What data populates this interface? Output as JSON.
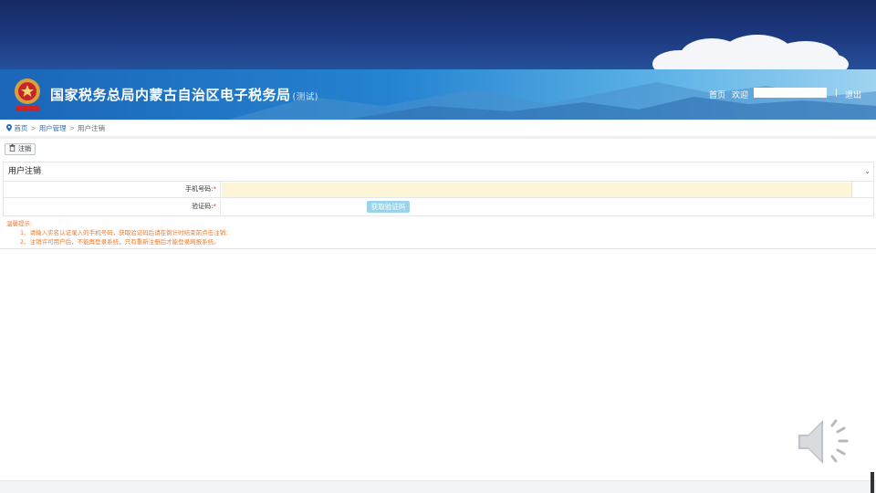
{
  "site": {
    "title": "国家税务总局内蒙古自治区电子税务局",
    "title_suffix": "(测试)"
  },
  "header_links": {
    "home": "首页",
    "welcome": "欢迎",
    "separator": "|",
    "logout": "退出"
  },
  "breadcrumb": {
    "home": "首页",
    "sep1": ">",
    "user_mgmt": "用户管理",
    "sep2": ">",
    "current": "用户注销"
  },
  "toolbar": {
    "cancel_label": "注销",
    "cancel_icon": "trash-icon"
  },
  "panel": {
    "title": "用户注销",
    "phone_label": "手机号码:",
    "code_label": "验证码:",
    "required_mark": "*",
    "phone_value": "",
    "get_code_label": "获取验证码"
  },
  "tips": {
    "title": "温馨提示:",
    "items": [
      "1、请输入实名认证录入的手机号码，获取验证码后请在倒计时结束前点击注销;",
      "2、注销许可用户后，不能再登录系统，只有重新注册后才能登录网报系统。"
    ]
  },
  "colors": {
    "header_blue": "#2583d1",
    "tip_orange": "#ea7a2f",
    "phone_field_bg": "#fdf6d6",
    "code_button": "#9bd4e9",
    "required_red": "#e53d2d"
  }
}
